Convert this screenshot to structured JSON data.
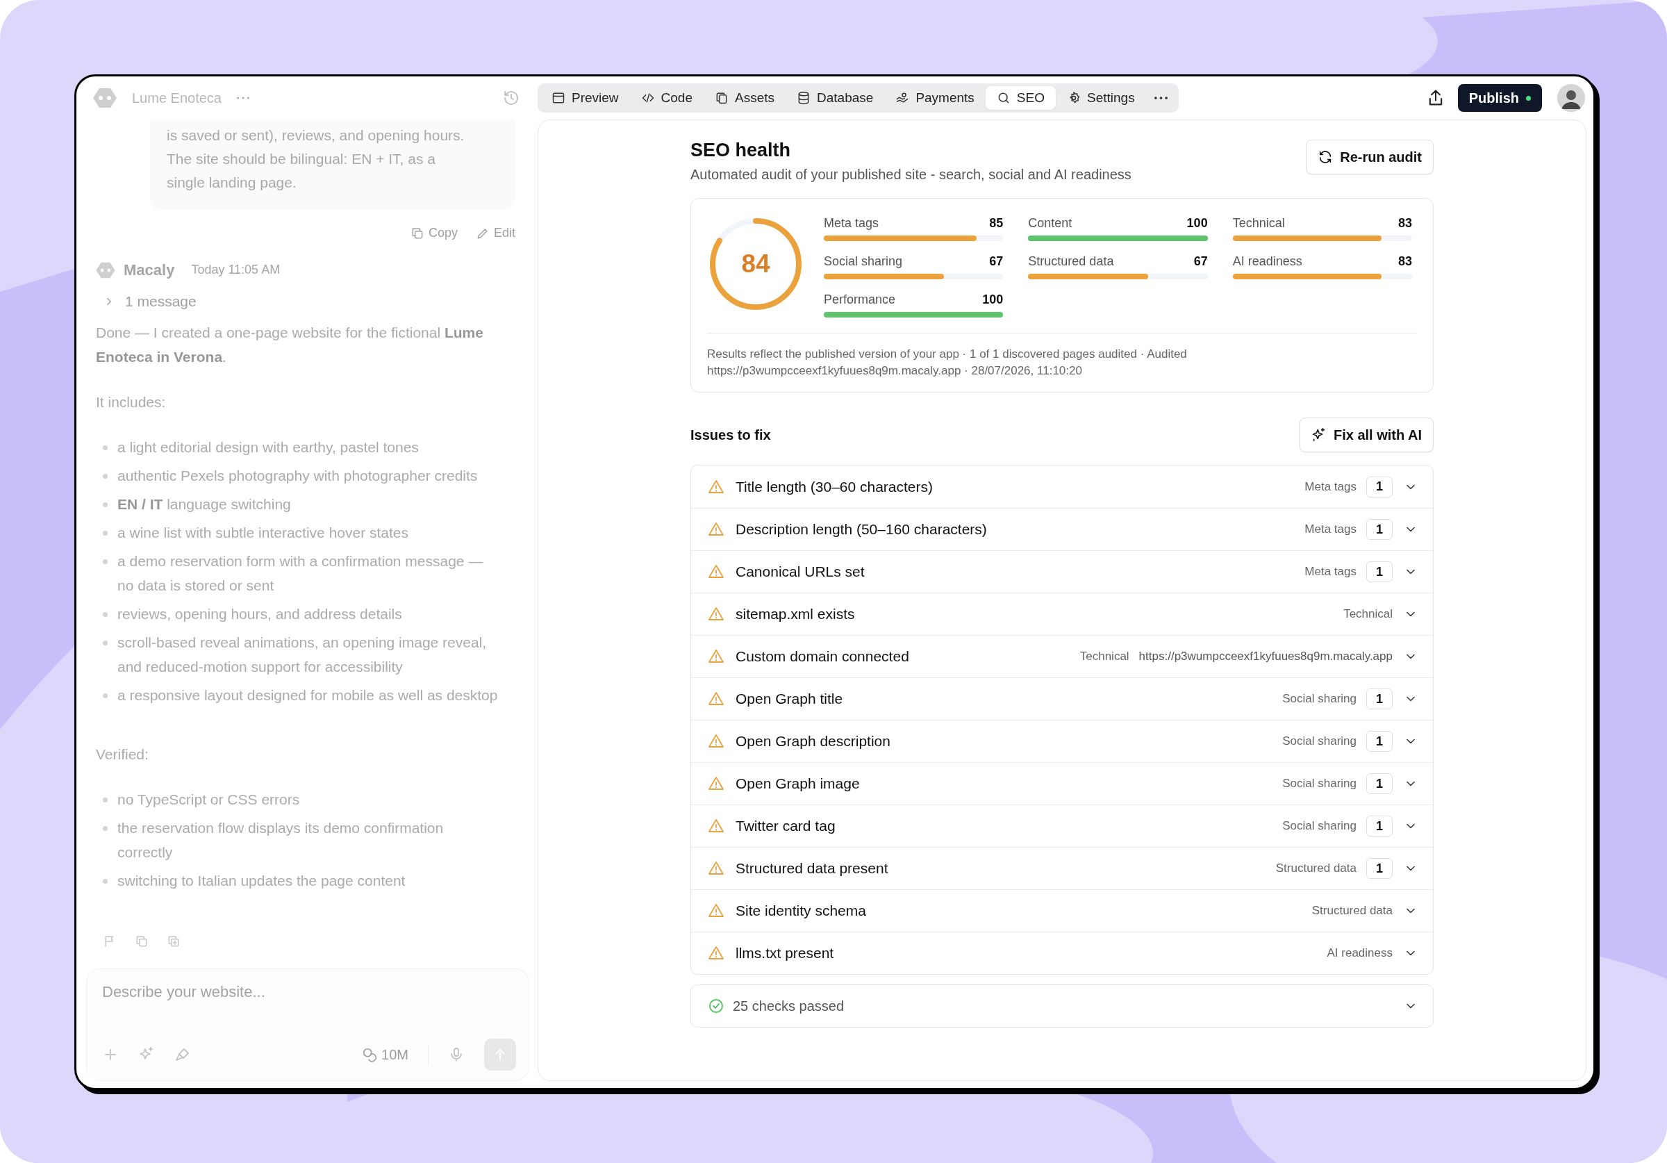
{
  "project": {
    "name": "Lume Enoteca"
  },
  "tabs": [
    {
      "label": "Preview",
      "selected": false
    },
    {
      "label": "Code",
      "selected": false
    },
    {
      "label": "Assets",
      "selected": false
    },
    {
      "label": "Database",
      "selected": false
    },
    {
      "label": "Payments",
      "selected": false
    },
    {
      "label": "SEO",
      "selected": true
    },
    {
      "label": "Settings",
      "selected": false
    }
  ],
  "publish_button": "Publish",
  "chat": {
    "user_message": "is saved or sent), reviews, and opening hours. The site should be bilingual: EN + IT, as a single landing page.",
    "message_actions": [
      "Copy",
      "Edit"
    ],
    "assistant": {
      "name": "Macaly",
      "time": "Today 11:05 AM",
      "collapsed": "1 message",
      "blocks": [
        {
          "kind": "paragraph",
          "text": "Done — I created a one-page website for the fictional **Lume Enoteca in Verona**."
        },
        {
          "kind": "paragraph",
          "text": "It includes:"
        },
        {
          "kind": "list",
          "items": [
            "a light editorial design with earthy, pastel tones",
            "authentic Pexels photography with photographer credits",
            "**EN / IT** language switching",
            "a wine list with subtle interactive hover states",
            "a demo reservation form with a confirmation message — no data is stored or sent",
            "reviews, opening hours, and address details",
            "scroll-based reveal animations, an opening image reveal, and reduced-motion support for accessibility",
            "a responsive layout designed for mobile as well as desktop"
          ]
        },
        {
          "kind": "paragraph",
          "text": "Verified:"
        },
        {
          "kind": "list",
          "items": [
            "no TypeScript or CSS errors",
            "the reservation flow displays its demo confirmation correctly",
            "switching to Italian updates the page content"
          ]
        }
      ]
    },
    "composer": {
      "placeholder": "Describe your website...",
      "credits": "10M"
    }
  },
  "seo": {
    "title": "SEO health",
    "subtitle": "Automated audit of your published site - search, social and AI readiness",
    "rerun_button": "Re-run audit",
    "score": {
      "value": "84",
      "level": 0.84
    },
    "metrics": [
      {
        "name": "Meta tags",
        "value": "85",
        "level": 0.85,
        "color": "#eba23c"
      },
      {
        "name": "Content",
        "value": "100",
        "level": 1,
        "color": "#5ec46b"
      },
      {
        "name": "Technical",
        "value": "83",
        "level": 0.83,
        "color": "#eba23c"
      },
      {
        "name": "Social sharing",
        "value": "67",
        "level": 0.67,
        "color": "#eba23c"
      },
      {
        "name": "Structured data",
        "value": "67",
        "level": 0.67,
        "color": "#eba23c"
      },
      {
        "name": "AI readiness",
        "value": "83",
        "level": 0.83,
        "color": "#eba23c"
      },
      {
        "name": "Performance",
        "value": "100",
        "level": 1,
        "color": "#5ec46b"
      }
    ],
    "note": "Results reflect the published version of your app · 1 of 1 discovered pages audited · Audited https://p3wumpcceexf1kyfuues8q9m.macaly.app · 28/07/2026, 11:10:20"
  },
  "issues": {
    "title": "Issues to fix",
    "fix_button": "Fix all with AI",
    "items": [
      {
        "title": "Title length (30–60 characters)",
        "category": "Meta tags",
        "count": "1"
      },
      {
        "title": "Description length (50–160 characters)",
        "category": "Meta tags",
        "count": "1"
      },
      {
        "title": "Canonical URLs set",
        "category": "Meta tags",
        "count": "1"
      },
      {
        "title": "sitemap.xml exists",
        "category": "Technical"
      },
      {
        "title": "Custom domain connected",
        "category": "Technical",
        "detail": "https://p3wumpcceexf1kyfuues8q9m.macaly.app"
      },
      {
        "title": "Open Graph title",
        "category": "Social sharing",
        "count": "1"
      },
      {
        "title": "Open Graph description",
        "category": "Social sharing",
        "count": "1"
      },
      {
        "title": "Open Graph image",
        "category": "Social sharing",
        "count": "1"
      },
      {
        "title": "Twitter card tag",
        "category": "Social sharing",
        "count": "1"
      },
      {
        "title": "Structured data present",
        "category": "Structured data",
        "count": "1"
      },
      {
        "title": "Site identity schema",
        "category": "Structured data"
      },
      {
        "title": "llms.txt present",
        "category": "AI readiness"
      }
    ],
    "passed": "25 checks passed"
  }
}
